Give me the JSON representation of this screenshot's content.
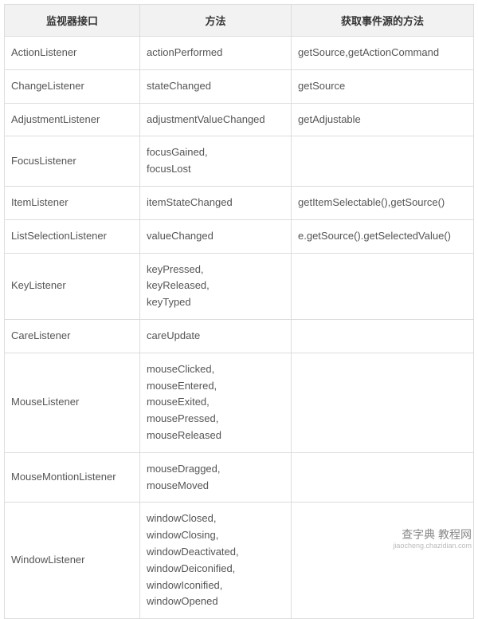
{
  "table": {
    "headers": [
      "监视器接口",
      "方法",
      "获取事件源的方法"
    ],
    "rows": [
      {
        "iface": "ActionListener",
        "methods": "actionPerformed",
        "source": "getSource,getActionCommand"
      },
      {
        "iface": "ChangeListener",
        "methods": "stateChanged",
        "source": "getSource"
      },
      {
        "iface": "AdjustmentListener",
        "methods": "adjustmentValueChanged",
        "source": "getAdjustable"
      },
      {
        "iface": "FocusListener",
        "methods": "focusGained,\nfocusLost",
        "source": ""
      },
      {
        "iface": "ItemListener",
        "methods": "itemStateChanged",
        "source": "getItemSelectable(),getSource()"
      },
      {
        "iface": "ListSelectionListener",
        "methods": "valueChanged",
        "source": "e.getSource().getSelectedValue()"
      },
      {
        "iface": "KeyListener",
        "methods": "keyPressed,\nkeyReleased,\nkeyTyped",
        "source": ""
      },
      {
        "iface": "CareListener",
        "methods": "careUpdate",
        "source": ""
      },
      {
        "iface": "MouseListener",
        "methods": "mouseClicked,\nmouseEntered,\nmouseExited,\nmousePressed,\nmouseReleased",
        "source": ""
      },
      {
        "iface": "MouseMontionListener",
        "methods": "mouseDragged,\nmouseMoved",
        "source": ""
      },
      {
        "iface": "WindowListener",
        "methods": "windowClosed,\nwindowClosing,\nwindowDeactivated,\nwindowDeiconified,\nwindowIconified,\nwindowOpened",
        "source": ""
      }
    ]
  },
  "watermark": {
    "cn": "查字典 教程网",
    "en": "jiaocheng.chazidian.com"
  }
}
